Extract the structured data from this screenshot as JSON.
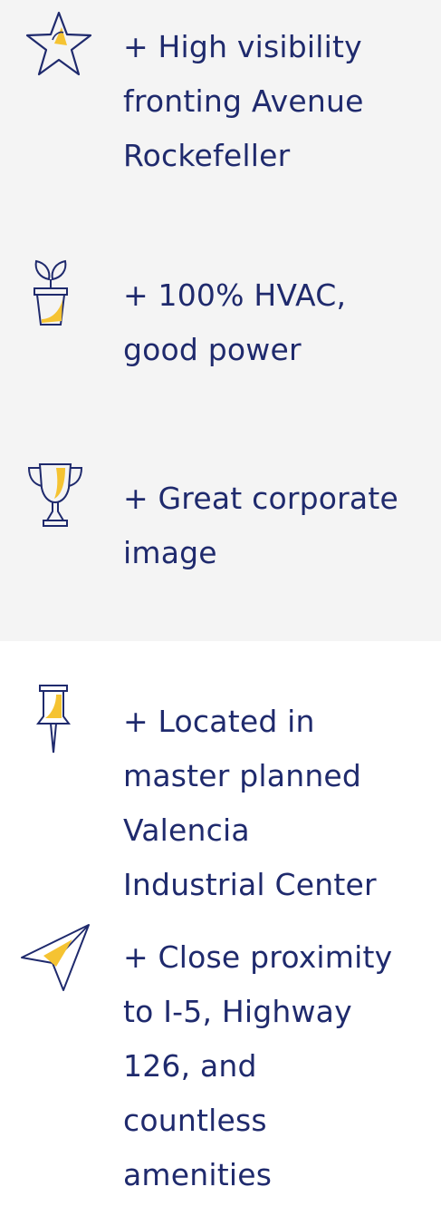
{
  "features": [
    {
      "icon": "star-icon",
      "text": "+ High visibility\n fronting Avenue\n Rockefeller"
    },
    {
      "icon": "plant-pot-icon",
      "text": "+ 100% HVAC,\n good power"
    },
    {
      "icon": "trophy-icon",
      "text": "+ Great corporate\n image"
    },
    {
      "icon": "pushpin-icon",
      "text": "+ Located in\n master planned\n Valencia\n Industrial Center"
    },
    {
      "icon": "paper-plane-icon",
      "text": "+ Close proximity\n to I-5, Highway\n 126, and\n countless\n amenities"
    }
  ],
  "colors": {
    "navy": "#1f2a6d",
    "accent": "#f5c332",
    "gray_panel": "#f4f4f4"
  }
}
